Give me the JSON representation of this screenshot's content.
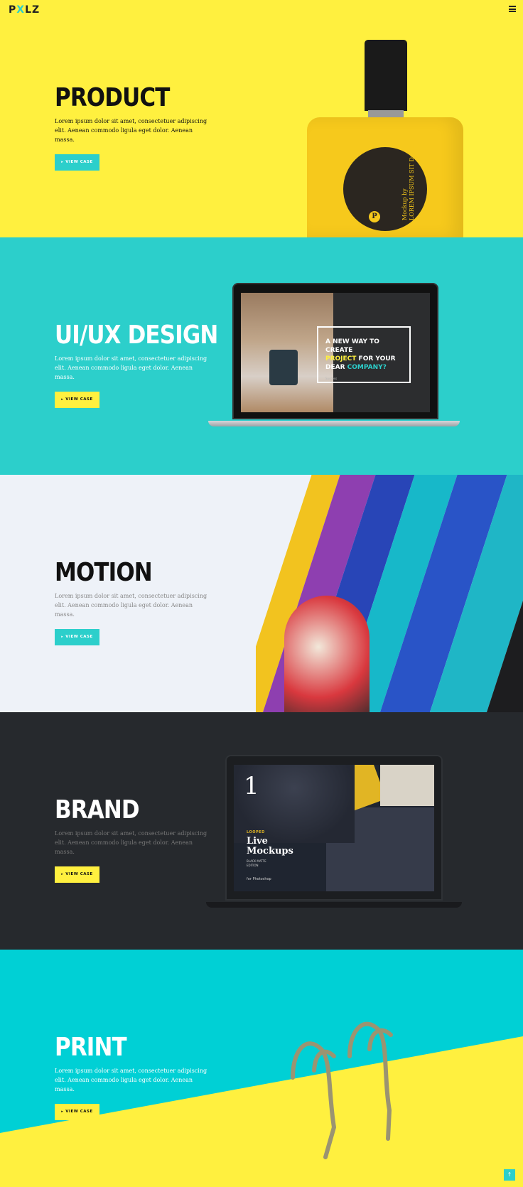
{
  "header": {
    "logo_prefix": "P",
    "logo_accent": "X",
    "logo_suffix": "LZ"
  },
  "sections": [
    {
      "title": "PRODUCT",
      "desc": "Lorem ipsum dolor sit amet, consectetuer adipiscing elit. Aenean commodo ligula eget dolor. Aenean massa.",
      "button": "VIEW CASE",
      "bg": "#fff03f"
    },
    {
      "title": "UI/UX DESIGN",
      "desc": "Lorem ipsum dolor sit amet, consectetuer adipiscing elit. Aenean commodo ligula eget dolor. Aenean massa.",
      "button": "VIEW CASE",
      "bg": "#2ccfcb"
    },
    {
      "title": "MOTION",
      "desc": "Lorem ipsum dolor sit amet, consectetuer adipiscing elit. Aenean commodo ligula eget dolor. Aenean massa.",
      "button": "VIEW CASE",
      "bg": "#eef2f8"
    },
    {
      "title": "BRAND",
      "desc": "Lorem ipsum dolor sit amet, consectetuer adipiscing elit. Aenean commodo ligula eget dolor. Aenean massa.",
      "button": "VIEW CASE",
      "bg": "#26292d"
    },
    {
      "title": "PRINT",
      "desc": "Lorem ipsum dolor sit amet, consectetuer adipiscing elit. Aenean commodo ligula eget dolor. Aenean massa.",
      "button": "VIEW CASE",
      "bg": "#00d0d5"
    }
  ],
  "product_mockup": {
    "label_line1": "Mockup by",
    "label_line2": "LOREM IPSUM SIT Dolor",
    "badge": "P"
  },
  "uiux_mockup": {
    "line1": "A NEW WAY TO CREATE",
    "line2a": "PROJECT",
    "line2b": " FOR YOUR",
    "line3a": "DEAR ",
    "line3b": "COMPANY?",
    "small": "Success"
  },
  "brand_mockup": {
    "number": "1",
    "looped": "LOOPED",
    "live": "Live",
    "mockups": "Mockups",
    "edition1": "BLACK MATTE",
    "edition2": "EDITION",
    "for_ps": "for Photoshop"
  },
  "icons": {
    "menu": "hamburger-icon",
    "button_arrow": "arrow-icon",
    "top": "arrow-up-icon"
  },
  "back_to_top": "↑",
  "colors": {
    "yellow": "#fff03f",
    "teal": "#2ccfcb",
    "dark": "#26292d"
  }
}
